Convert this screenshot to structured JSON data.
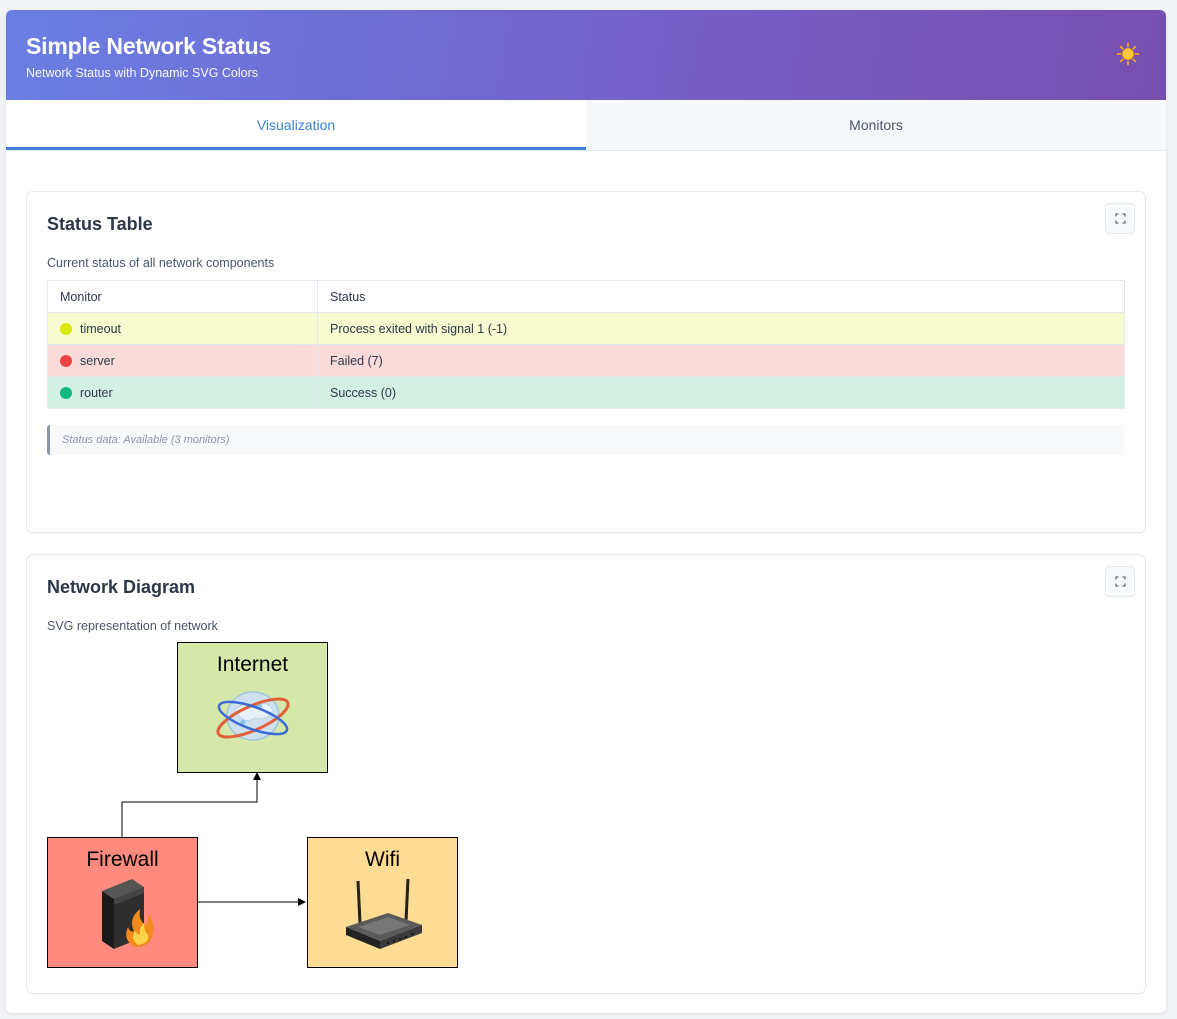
{
  "header": {
    "title": "Simple Network Status",
    "subtitle": "Network Status with Dynamic SVG Colors",
    "theme_icon": "sun-icon"
  },
  "tabs": [
    {
      "label": "Visualization",
      "active": true
    },
    {
      "label": "Monitors",
      "active": false
    }
  ],
  "status_table": {
    "title": "Status Table",
    "description": "Current status of all network components",
    "columns": [
      "Monitor",
      "Status"
    ],
    "rows": [
      {
        "monitor": "timeout",
        "status": "Process exited with signal 1 (-1)",
        "dot_color": "#d9e80b",
        "row_color": "#f7fbcf"
      },
      {
        "monitor": "server",
        "status": "Failed (7)",
        "dot_color": "#ef4444",
        "row_color": "#fbdada"
      },
      {
        "monitor": "router",
        "status": "Success (0)",
        "dot_color": "#10b981",
        "row_color": "#d3f0e5"
      }
    ],
    "note": "Status data: Available (3 monitors)"
  },
  "network_diagram": {
    "title": "Network Diagram",
    "description": "SVG representation of network",
    "nodes": [
      {
        "label": "Internet",
        "color": "#d5e8a9",
        "icon": "globe-icon"
      },
      {
        "label": "Firewall",
        "color": "#fe8b7d",
        "icon": "firewall-icon"
      },
      {
        "label": "Wifi",
        "color": "#fedc93",
        "icon": "router-icon"
      }
    ]
  }
}
